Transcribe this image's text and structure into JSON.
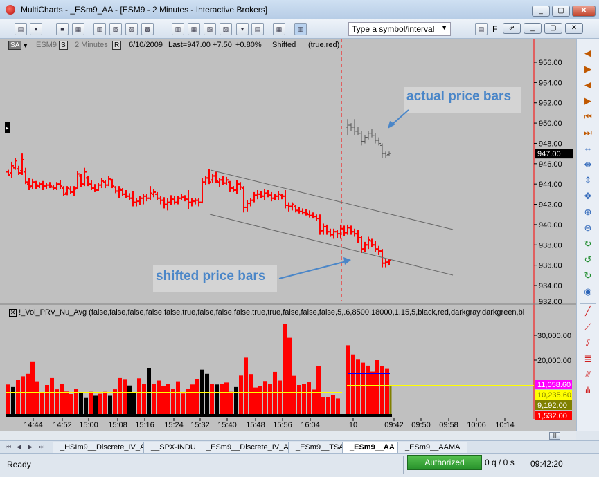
{
  "window": {
    "title": "MultiCharts - _ESm9_AA - [ESM9 - 2 Minutes - Interactive Brokers]",
    "minimize_label": "_",
    "maximize_label": "▢",
    "close_label": "✕"
  },
  "toolbar": {
    "symbol_placeholder": "Type a symbol/interval",
    "f_label": "F"
  },
  "infobar": {
    "data_series": "SA",
    "symbol": "ESM9",
    "s_button": "S",
    "interval": "2 Minutes",
    "r_button": "R",
    "date": "6/10/2009",
    "last": "Last=947.00",
    "change": "+7.50",
    "change_pct": "+0.80%",
    "study_name": "Shifted",
    "study_args": "(true,red)"
  },
  "indicator": {
    "label": "!_Vol_PRV_Nu_Avg  (false,false,false,false,false,true,false,false,false,true,true,false,false,false,5,.6,8500,18000,1.15,5,black,red,darkgray,darkgreen,bl"
  },
  "annotations": {
    "actual": "actual price bars",
    "shifted": "shifted price bars"
  },
  "price_axis": {
    "ticks": [
      "956.00",
      "954.00",
      "952.00",
      "950.00",
      "948.00",
      "946.00",
      "944.00",
      "942.00",
      "940.00",
      "938.00",
      "936.00",
      "934.00"
    ],
    "current_price": "947.00",
    "bottom_cut": "932.00"
  },
  "volume_axis": {
    "ticks": [
      "30,000.00",
      "20,000.00"
    ],
    "badges": [
      {
        "text": "11,058.60",
        "bg": "#ff00ff",
        "fg": "#ffffff"
      },
      {
        "text": "10,235.60",
        "bg": "#ffff00",
        "fg": "#7f7f00"
      },
      {
        "text": "9,192.00",
        "bg": "#808000",
        "fg": "#ffffff"
      },
      {
        "text": "1,532.00",
        "bg": "#ff0000",
        "fg": "#ffffff"
      }
    ]
  },
  "time_axis": [
    "14:44",
    "14:52",
    "15:00",
    "15:08",
    "15:16",
    "15:24",
    "15:32",
    "15:40",
    "15:48",
    "15:56",
    "16:04",
    "10",
    "09:42",
    "09:50",
    "09:58",
    "10:06",
    "10:14"
  ],
  "colors": {
    "chart_bg": "#c0c0c0",
    "up_bar": "#ff0000",
    "down_bar": "#000000",
    "average": "#ffff00",
    "annotation": "#4a86c8"
  },
  "tabs": [
    {
      "label": "_HSIm9__Discrete_IV_A",
      "active": false
    },
    {
      "label": "__SPX-INDU",
      "active": false
    },
    {
      "label": "_ESm9__Discrete_IV_A",
      "active": false
    },
    {
      "label": "_ESm9__TSA",
      "active": false
    },
    {
      "label": "_ESm9__AA",
      "active": true
    },
    {
      "label": "_ESm9__AAMA",
      "active": false
    }
  ],
  "status": {
    "ready": "Ready",
    "authorized": "Authorized",
    "orders": "0 q / 0 s",
    "clock": "09:42:20"
  }
}
